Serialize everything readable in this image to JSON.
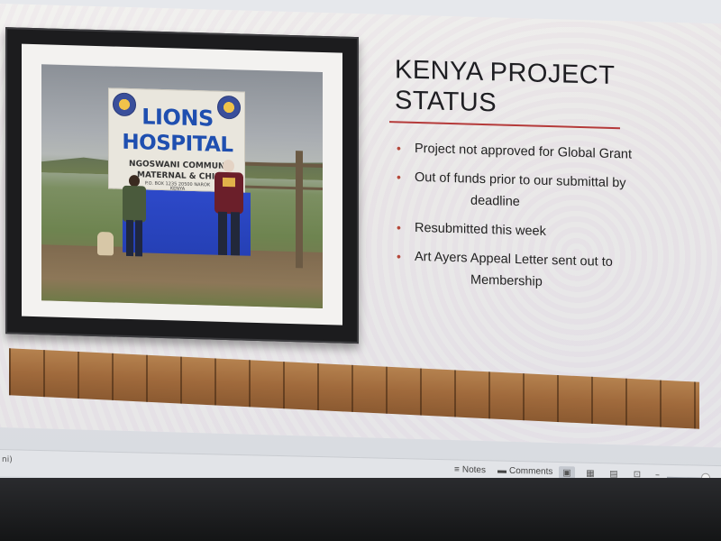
{
  "slide": {
    "title_line1": "KENYA PROJECT",
    "title_line2": "STATUS",
    "bullets": [
      {
        "text": "Project not approved for Global Grant"
      },
      {
        "text": "Out of funds prior to our submittal by",
        "continuation": "deadline"
      },
      {
        "text": "Resubmitted this week"
      },
      {
        "text": "Art Ayers Appeal Letter sent out to",
        "continuation": "Membership"
      }
    ],
    "bullet_glyph": "•",
    "accent_color": "#b5473a",
    "photo_sign": {
      "line1": "LIONS",
      "line2": "HOSPITAL",
      "line3": "NGOSWANI COMMUNI",
      "line4": "MATERNAL & CHIL",
      "line5": "P.O. BOX 1235 20500 NAROK",
      "line6": "KENYA"
    }
  },
  "statusbar": {
    "left_text": "ni)",
    "notes_label": "Notes",
    "comments_label": "Comments",
    "zoom_minus": "–",
    "icons": [
      "notes-icon",
      "comments-icon",
      "normal-view-icon",
      "slide-sorter-icon",
      "reading-view-icon",
      "slideshow-icon"
    ]
  }
}
